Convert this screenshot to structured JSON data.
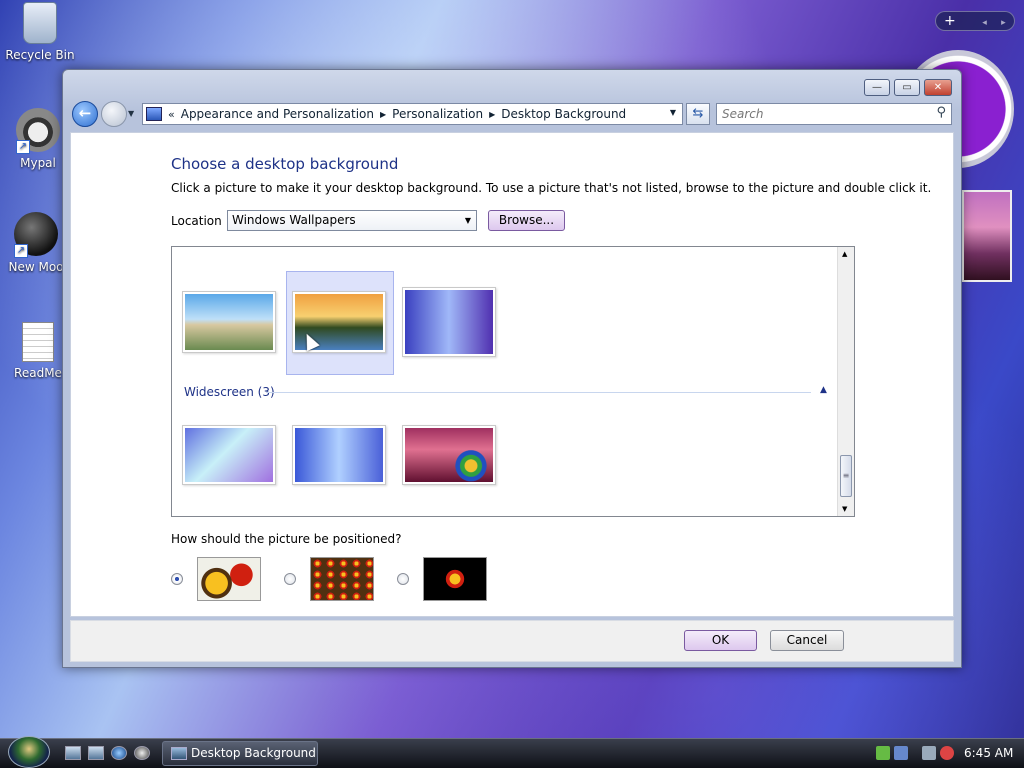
{
  "desktop": {
    "icons": [
      {
        "label": "Recycle Bin"
      },
      {
        "label": "Mypal"
      },
      {
        "label": "New Moo"
      },
      {
        "label": "ReadMe"
      }
    ]
  },
  "sidebar": {
    "add_label": "+",
    "prev_label": "◂",
    "next_label": "▸"
  },
  "window": {
    "controls": {
      "minimize": "—",
      "maximize": "▭",
      "close": "✕"
    },
    "nav": {
      "back": "←",
      "refresh": "⇆"
    },
    "address": {
      "crumbs": [
        "Appearance and Personalization",
        "Personalization",
        "Desktop Background"
      ]
    },
    "search": {
      "placeholder": "Search"
    },
    "heading": "Choose a desktop background",
    "description": "Click a picture to make it your desktop background. To use a picture that's not listed, browse to the picture and double click it.",
    "location": {
      "label": "Location",
      "value": "Windows Wallpapers",
      "browse": "Browse..."
    },
    "gallery": {
      "group_label": "Widescreen (3)"
    },
    "position": {
      "question": "How should the picture be positioned?"
    },
    "buttons": {
      "ok": "OK",
      "cancel": "Cancel"
    }
  },
  "taskbar": {
    "task_label": "Desktop Background",
    "time": "6:45 AM"
  },
  "colors": {
    "accent": "#1e3287",
    "selection": "#dde2fb",
    "button_purple": "#ddc8ee"
  }
}
